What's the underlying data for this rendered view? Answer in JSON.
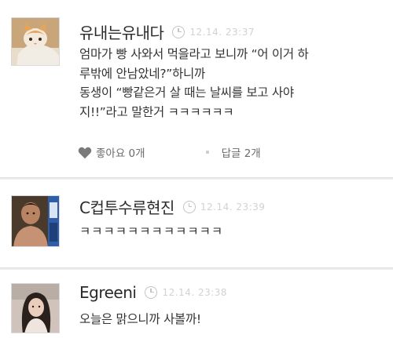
{
  "comments": [
    {
      "nickname": "유내는유내다",
      "time": "12.14. 23:37",
      "lines": [
        "엄마가 빵 사와서 먹을라고 보니까 “어 이거 하",
        "루밖에 안남았네?”하니까",
        "동생이 “빵같은거 살 때는 날씨를 보고 사야",
        "지!!”라고 말한거 ㅋㅋㅋㅋㅋㅋ"
      ],
      "like_label": "좋아요 0개",
      "reply_label": "답글 2개"
    },
    {
      "nickname": "C컵투수류현진",
      "time": "12.14. 23:39",
      "lines": [
        "ㅋㅋㅋㅋㅋㅋㅋㅋㅋㅋㅋㅋ"
      ]
    },
    {
      "nickname": "Egreeni",
      "time": "12.14. 23:38",
      "lines": [
        "오늘은 맑으니까 사볼까!"
      ]
    }
  ],
  "colors": {
    "timestamp": "#d2d2d2",
    "separator": "#ececec",
    "action_text": "#6b6b6b"
  }
}
